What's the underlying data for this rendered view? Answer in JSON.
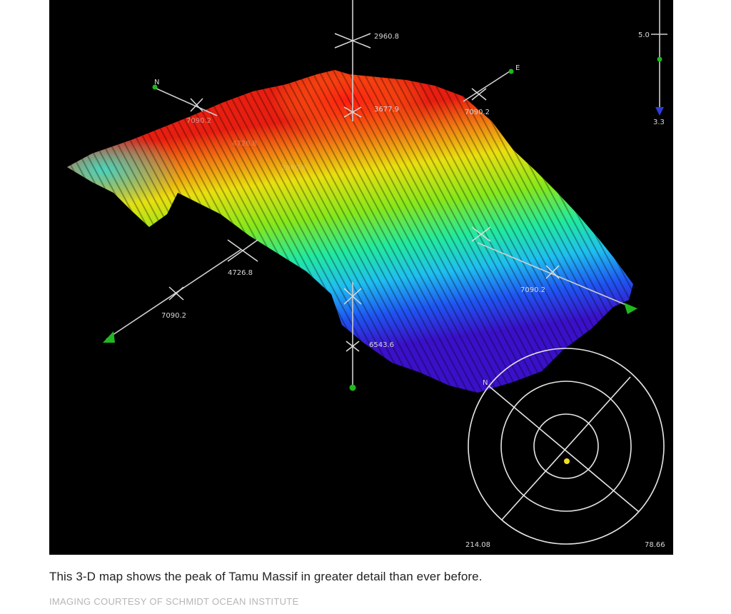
{
  "figure": {
    "labels": {
      "depth_top": "2960.8",
      "peak": "3677.9",
      "east_axis": "7090.2",
      "north_axis": "7090.2",
      "left_cross": "4726.8",
      "left_lower": "7090.2",
      "right_lower": "7090.2",
      "bottom_axis": "6543.6",
      "faint_1": "4726.8",
      "faint_2": "2960.8"
    },
    "compass": {
      "north_top": "N",
      "east_top": "E",
      "dial_north": "N"
    },
    "scale": {
      "top_value": "5.0",
      "bottom_value": "3.3"
    },
    "corner": {
      "left_value": "214.08",
      "right_value": "78.66"
    }
  },
  "caption": "This 3-D map shows the peak of Tamu Massif in greater detail than ever before.",
  "credit": "IMAGING COURTESY OF SCHMIDT OCEAN INSTITUTE"
}
